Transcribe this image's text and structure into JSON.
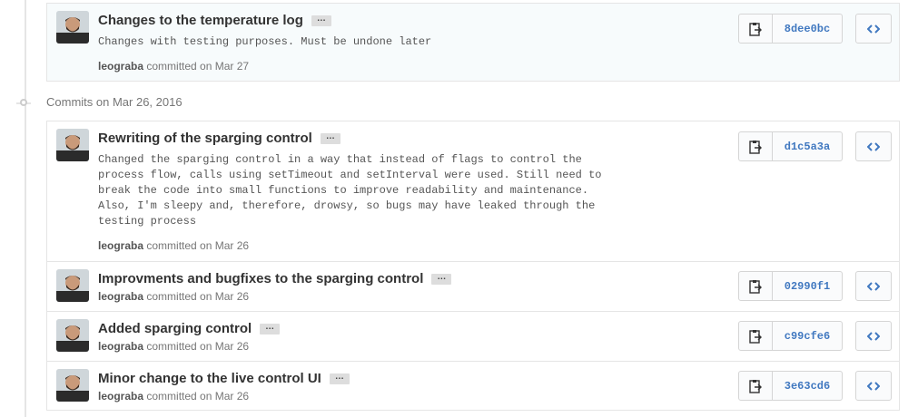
{
  "group_prev": {
    "commits": [
      {
        "title": "Changes to the temperature log",
        "description": "Changes with testing purposes. Must be undone later",
        "author": "leograba",
        "committed_text": "committed on Mar 27",
        "sha": "8dee0bc"
      }
    ]
  },
  "group_mar26": {
    "header": "Commits on Mar 26, 2016",
    "commits": [
      {
        "title": "Rewriting of the sparging control",
        "description": "Changed the sparging control in a way that instead of flags to control the\nprocess flow, calls using setTimeout and setInterval were used. Still need to\nbreak the code into small functions to improve readability and maintenance.\nAlso, I'm sleepy and, therefore, drowsy, so bugs may have leaked through the\ntesting process",
        "author": "leograba",
        "committed_text": "committed on Mar 26",
        "sha": "d1c5a3a"
      },
      {
        "title": "Improvments and bugfixes to the sparging control",
        "author": "leograba",
        "committed_text": "committed on Mar 26",
        "sha": "02990f1"
      },
      {
        "title": "Added sparging control",
        "author": "leograba",
        "committed_text": "committed on Mar 26",
        "sha": "c99cfe6"
      },
      {
        "title": "Minor change to the live control UI",
        "author": "leograba",
        "committed_text": "committed on Mar 26",
        "sha": "3e63cd6"
      }
    ]
  },
  "ui": {
    "ellipsis": "…",
    "copy_icon": "clipboard-icon",
    "browse_icon": "code-icon",
    "link_color": "#4078c0"
  }
}
